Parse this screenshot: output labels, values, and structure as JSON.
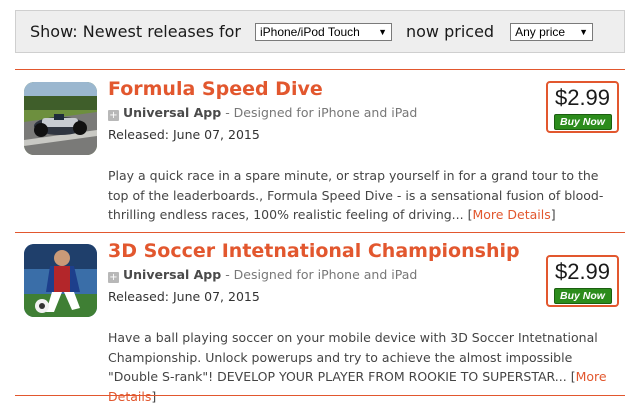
{
  "filter": {
    "show_label": "Show:",
    "newest_label": "Newest releases for",
    "platform_selected": "iPhone/iPod Touch",
    "now_priced_label": "now priced",
    "price_selected": "Any price"
  },
  "apps": [
    {
      "title": "Formula Speed Dive",
      "universal_label": "Universal App",
      "designed_for": " - Designed for iPhone and iPad",
      "released": "Released: June 07, 2015",
      "description": "Play a quick race in a spare minute, or strap yourself in for a grand tour to the top of the leaderboards., Formula Speed Dive - is a sensational fusion of blood-thrilling endless races, 100% realistic feeling of driving...",
      "more_details": "More Details",
      "price": "$2.99",
      "buy_label": "Buy Now"
    },
    {
      "title": "3D Soccer Intetnational Championship",
      "universal_label": "Universal App",
      "designed_for": " - Designed for iPhone and iPad",
      "released": "Released: June 07, 2015",
      "description": "Have a ball playing soccer on your mobile device with 3D Soccer Intetnational Championship. Unlock powerups and try to achieve the almost impossible \"Double S-rank\"! DEVELOP YOUR PLAYER FROM ROOKIE TO SUPERSTAR...",
      "more_details": "More Details",
      "price": "$2.99",
      "buy_label": "Buy Now"
    }
  ]
}
